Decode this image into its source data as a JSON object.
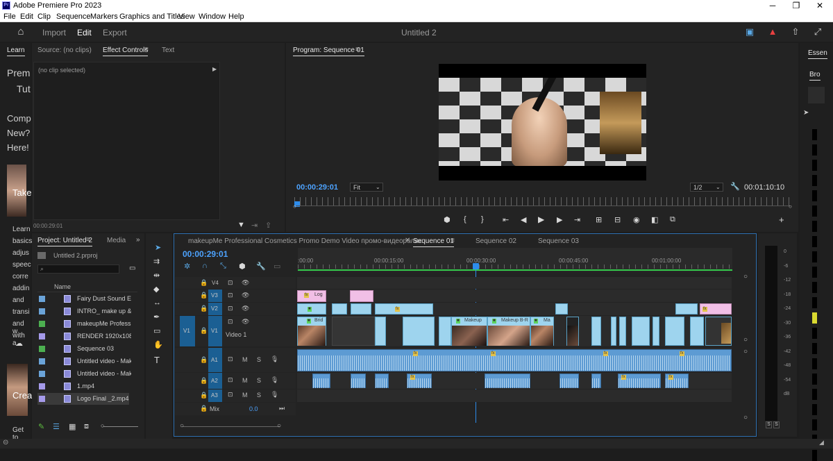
{
  "app": {
    "title": "Adobe Premiere Pro 2023",
    "icon_label": "Pr"
  },
  "menu": [
    "File",
    "Edit",
    "Clip",
    "Sequence",
    "Markers",
    "Graphics and Titles",
    "View",
    "Window",
    "Help"
  ],
  "header": {
    "tabs": [
      "Import",
      "Edit",
      "Export"
    ],
    "active_tab": "Edit",
    "project_title": "Untitled 2"
  },
  "learn": {
    "tab": "Learn",
    "lines": [
      "Prem",
      "Tut",
      "Comp",
      "New?",
      "Here!",
      "Take",
      "Learn",
      "basics",
      "adjus",
      "speec",
      "corre",
      "addin",
      "and",
      "transi",
      "and w",
      "with a",
      "Crea",
      "Get to"
    ]
  },
  "source_panel": {
    "tabs": [
      "Source: (no clips)",
      "Effect Controls",
      "Text"
    ],
    "active_tab": "Effect Controls",
    "no_clip": "(no clip selected)",
    "timecode": "00:00:29:01"
  },
  "program": {
    "title": "Program: Sequence 01",
    "timecode": "00:00:29:01",
    "fit": "Fit",
    "resolution": "1/2",
    "duration": "00:01:10:10"
  },
  "project": {
    "tabs": [
      "Project: Untitled 2",
      "Media"
    ],
    "filename": "Untitled 2.prproj",
    "column": "Name",
    "items": [
      {
        "name": "Fairy Dust Sound Eff",
        "color": "#6aa3d8"
      },
      {
        "name": "INTRO_ make up &",
        "color": "#6aa3d8"
      },
      {
        "name": "makeupMe Professi",
        "color": "#4caf50"
      },
      {
        "name": "RENDER 1920x1080",
        "color": "#a59aea"
      },
      {
        "name": "Sequence 03",
        "color": "#4caf50"
      },
      {
        "name": "Untitled video - Mak",
        "color": "#6aa3d8"
      },
      {
        "name": "Untitled video - Mak",
        "color": "#6aa3d8"
      },
      {
        "name": "1.mp4",
        "color": "#a59aea"
      },
      {
        "name": "Logo Final _2.mp4",
        "color": "#a59aea"
      }
    ]
  },
  "timeline": {
    "tabs": [
      "makeupMe Professional Cosmetics Promo Demo Video промо-видеоролик",
      "Sequence 01",
      "Sequence 02",
      "Sequence 03"
    ],
    "active_tab": "Sequence 01",
    "timecode": "00:00:29:01",
    "ruler": [
      ":00:00",
      "00:00:15:00",
      "00:00:30:00",
      "00:00:45:00",
      "00:01:00:00"
    ],
    "video_tracks": [
      "V4",
      "V3",
      "V2",
      "V1"
    ],
    "audio_tracks": [
      "A1",
      "A2",
      "A3"
    ],
    "video1_label": "Video 1",
    "mix_label": "Mix",
    "mix_value": "0.0",
    "src_patch": "V1",
    "track_buttons": {
      "mute": "M",
      "solo": "S"
    },
    "clip_labels": {
      "log": "Log",
      "brid": "Brid",
      "makeup": "Makeup",
      "makeup_b": "Makeup B-R",
      "ma": "Ma",
      "fx": "fx"
    }
  },
  "meter": {
    "labels": [
      "0",
      "-6",
      "-12",
      "-18",
      "-24",
      "-30",
      "-36",
      "-42",
      "-48",
      "-54",
      "dB"
    ],
    "solo": "S"
  },
  "essentials": {
    "tab": "Essen",
    "sub": "Bro"
  }
}
